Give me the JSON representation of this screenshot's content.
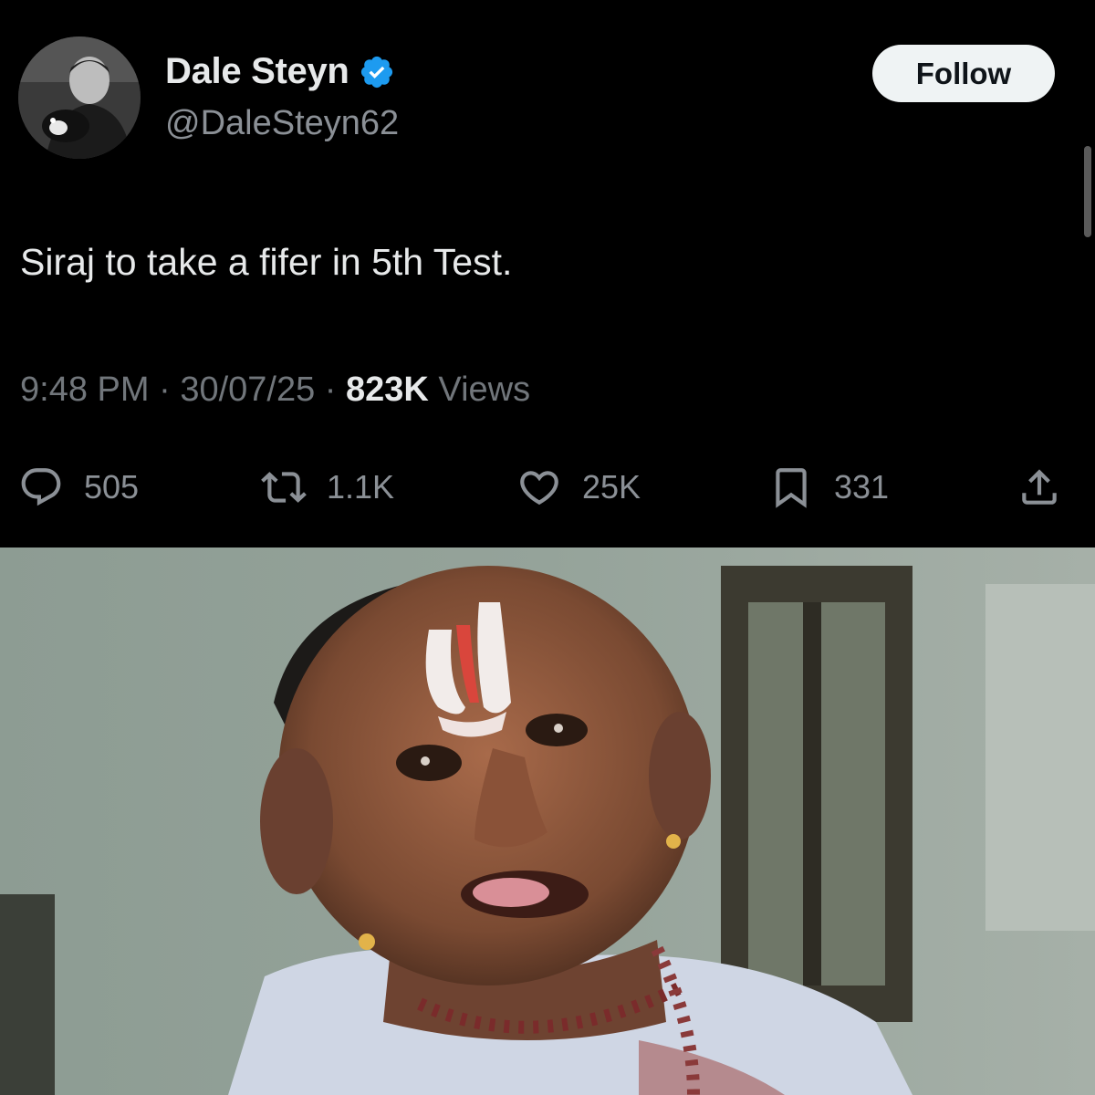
{
  "tweet": {
    "display_name": "Dale Steyn",
    "handle": "@DaleSteyn62",
    "follow_label": "Follow",
    "text": "Siraj to take a fifer in 5th Test.",
    "time": "9:48 PM",
    "separator": "·",
    "date": "30/07/25",
    "views_count": "823K",
    "views_label": "Views",
    "verified_color": "#1d9bf0"
  },
  "actions": {
    "replies": "505",
    "retweets": "1.1K",
    "likes": "25K",
    "bookmarks": "331"
  },
  "icons": [
    "verified-badge-icon",
    "reply-icon",
    "retweet-icon",
    "like-icon",
    "bookmark-icon",
    "share-icon"
  ]
}
